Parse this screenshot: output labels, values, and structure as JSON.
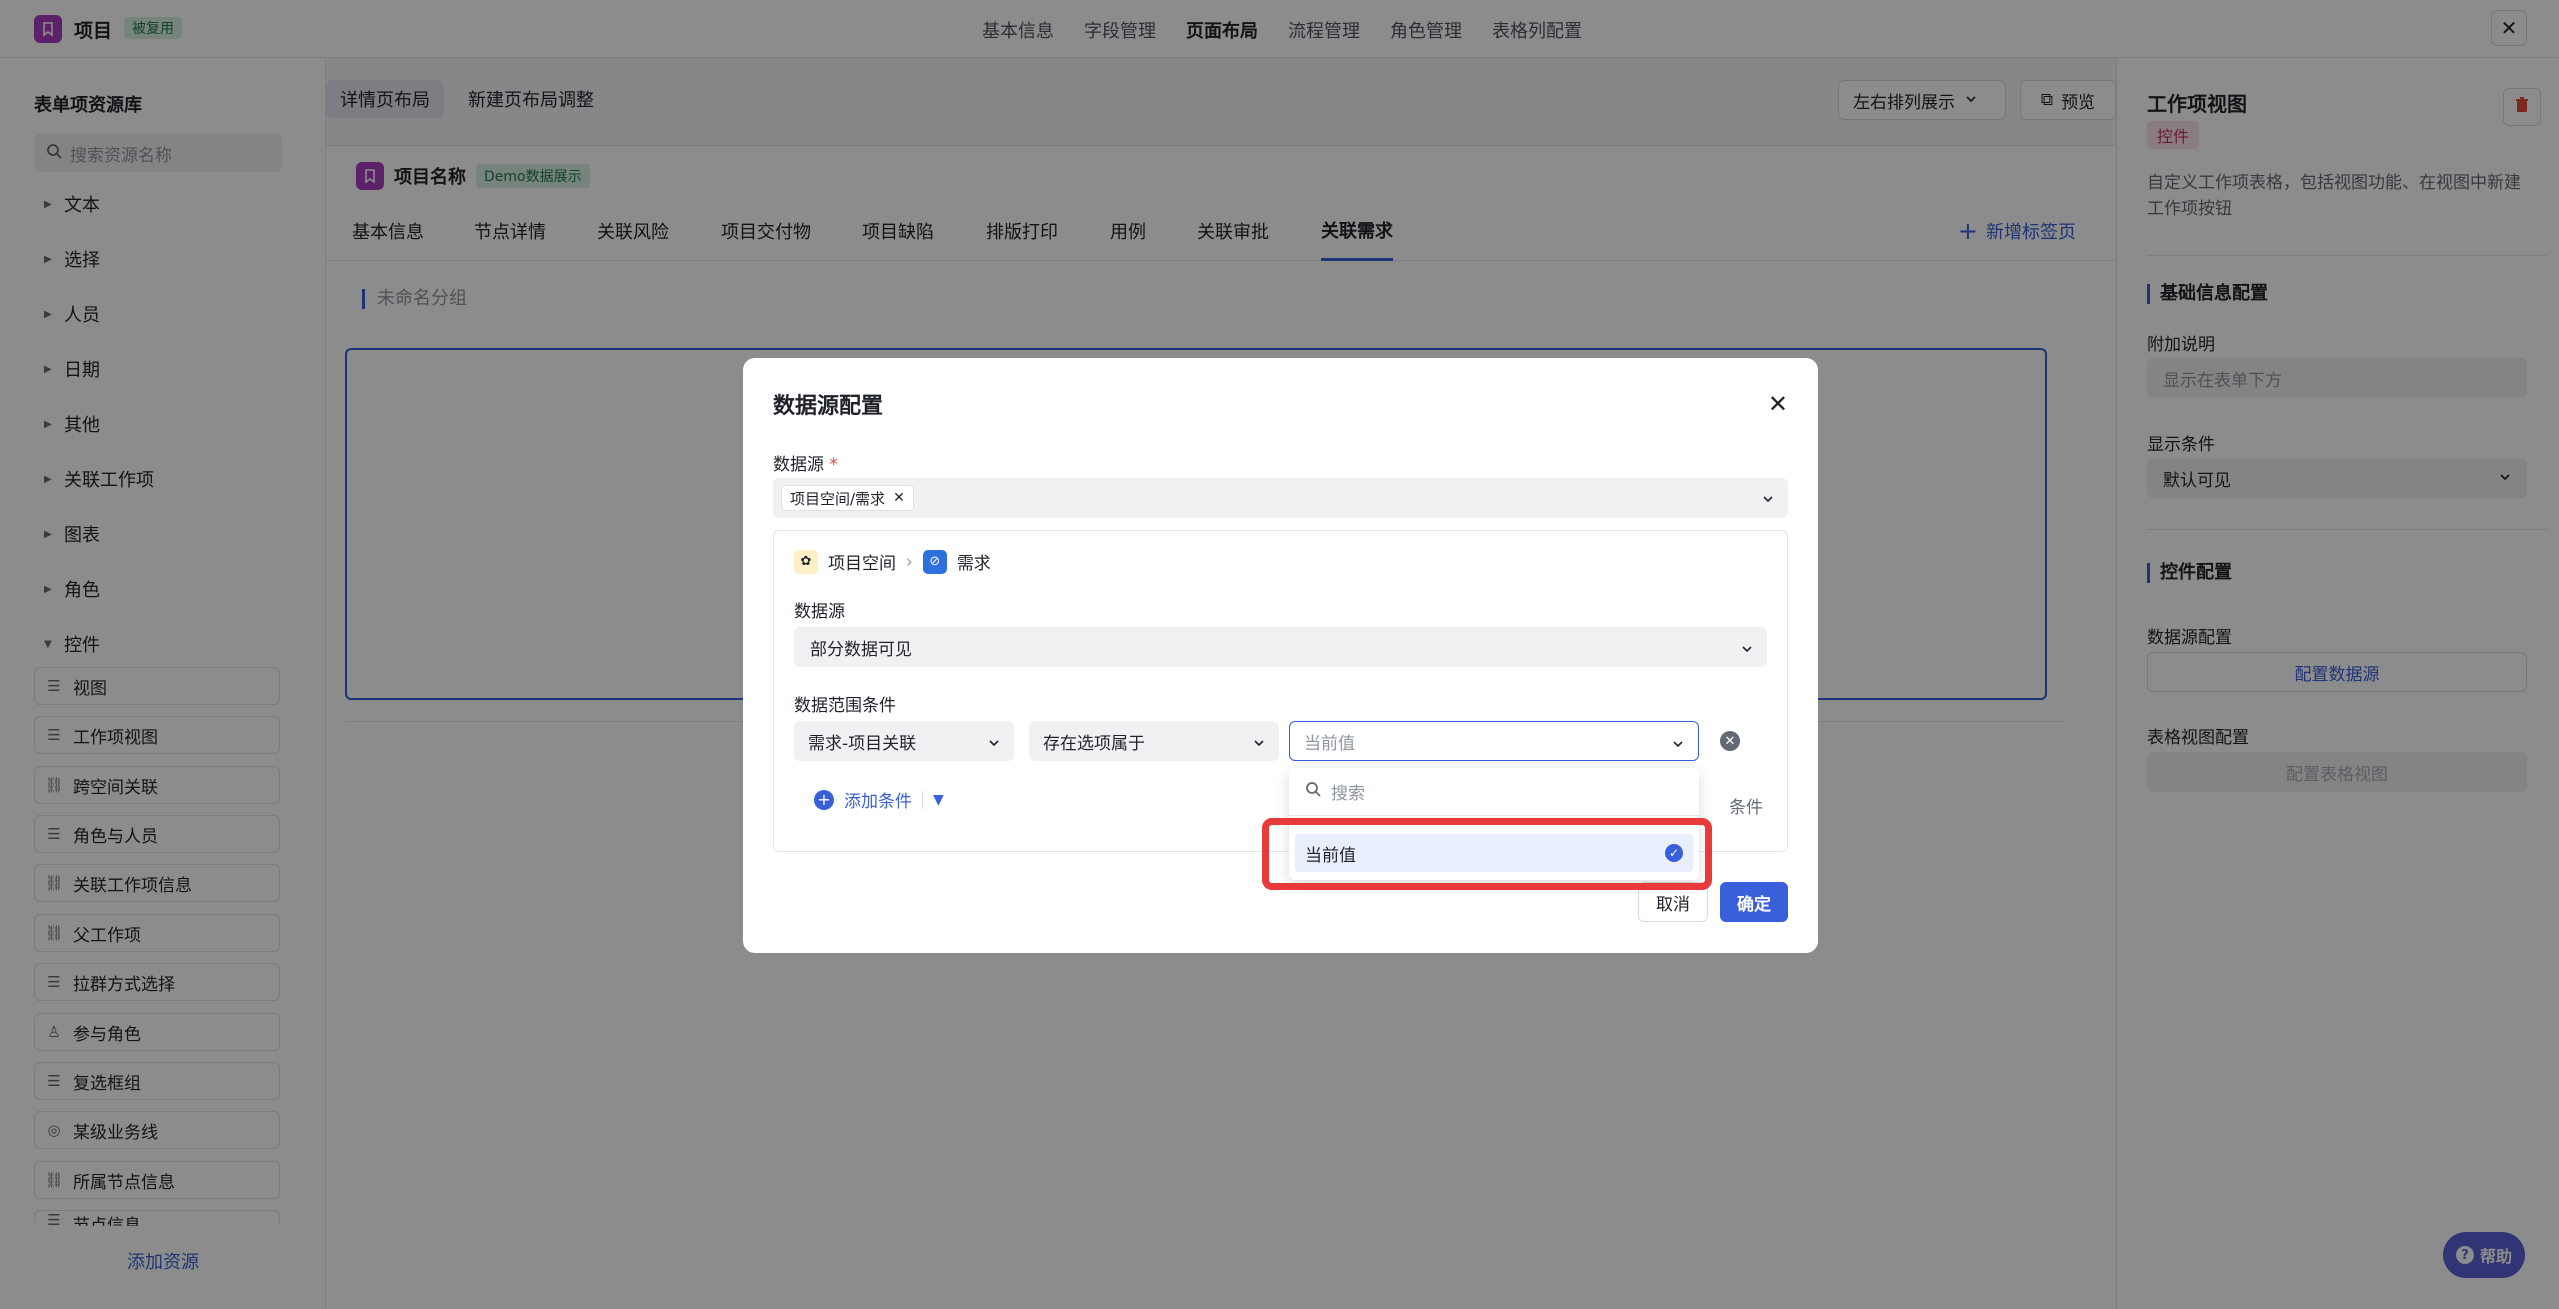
{
  "topbar": {
    "app_title": "项目",
    "badge": "被复用",
    "nav": [
      "基本信息",
      "字段管理",
      "页面布局",
      "流程管理",
      "角色管理",
      "表格列配置"
    ],
    "active_nav": "页面布局"
  },
  "sidebar": {
    "title": "表单项资源库",
    "search_placeholder": "搜索资源名称",
    "categories": [
      "文本",
      "选择",
      "人员",
      "日期",
      "其他",
      "关联工作项",
      "图表",
      "角色",
      "控件"
    ],
    "items": [
      "视图",
      "工作项视图",
      "跨空间关联",
      "角色与人员",
      "关联工作项信息",
      "父工作项",
      "拉群方式选择",
      "参与角色",
      "复选框组",
      "某级业务线",
      "所属节点信息",
      "节点信息"
    ],
    "add_resource": "添加资源"
  },
  "center": {
    "tabs": [
      "详情页布局",
      "新建页布局调整"
    ],
    "layout_select": "左右排列展示",
    "preview": "预览",
    "record_name": "项目名称",
    "demo_badge": "Demo数据展示",
    "subtabs": [
      "基本信息",
      "节点详情",
      "关联风险",
      "项目交付物",
      "项目缺陷",
      "排版打印",
      "用例",
      "关联审批",
      "关联需求"
    ],
    "active_subtab": "关联需求",
    "new_tab": "新增标签页",
    "group_label": "未命名分组"
  },
  "right_panel": {
    "title": "工作项视图",
    "badge": "控件",
    "description": "自定义工作项表格，包括视图功能、在视图中新建工作项按钮",
    "section_basic": "基础信息配置",
    "attach_label": "附加说明",
    "attach_placeholder": "显示在表单下方",
    "display_label": "显示条件",
    "display_value": "默认可见",
    "section_control": "控件配置",
    "datasource_label": "数据源配置",
    "datasource_btn": "配置数据源",
    "tableview_label": "表格视图配置",
    "tableview_btn": "配置表格视图"
  },
  "modal": {
    "title": "数据源配置",
    "ds_label": "数据源",
    "ds_tag": "项目空间/需求",
    "crumb_space": "项目空间",
    "crumb_item": "需求",
    "inner_ds_label": "数据源",
    "inner_ds_value": "部分数据可见",
    "range_label": "数据范围条件",
    "cond_field": "需求-项目关联",
    "cond_op": "存在选项属于",
    "cond_value_placeholder": "当前值",
    "add_condition": "添加条件",
    "side_text": "条件",
    "cancel": "取消",
    "ok": "确定"
  },
  "dropdown": {
    "search_placeholder": "搜索",
    "option": "当前值"
  },
  "help": "帮助"
}
